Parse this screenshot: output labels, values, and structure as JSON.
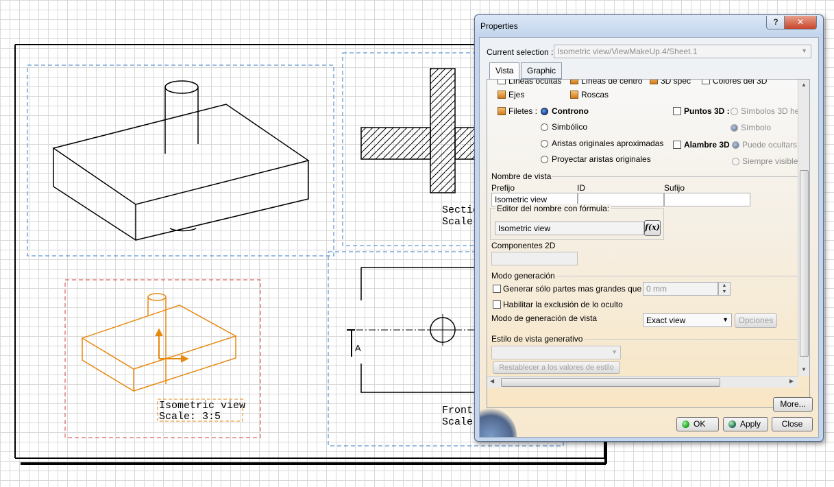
{
  "dialog": {
    "title": "Properties",
    "help": "?",
    "close_glyph": "✕",
    "current_selection_label": "Current selection :",
    "current_selection_value": "Isometric view/ViewMakeUp.4/Sheet.1",
    "tabs": [
      "Vista",
      "Graphic"
    ],
    "partial_row": {
      "a": "Líneas ocultas",
      "b": "Líneas de centro",
      "c": "3D spec",
      "d": "Colores del 3D"
    },
    "ejes": "Ejes",
    "roscas": "Roscas",
    "filetes": "Filetes :",
    "fillet_options": [
      "Controno",
      "Simbólico",
      "Aristas originales aproximadas",
      "Proyectar aristas originales"
    ],
    "puntos3d": "Puntos 3D :",
    "puntos_opts": [
      "Símbolos 3D he",
      "Símbolo"
    ],
    "alambre3d": "Alambre 3D",
    "alambre_opts": [
      "Puede ocultars",
      "Siempre visible"
    ],
    "view_name_section": "Nombre de vista",
    "prefix_label": "Prefijo",
    "id_label": "ID",
    "suffix_label": "Sufijo",
    "prefix_value": "Isometric view",
    "formula_editor_label": "Editor del nombre con fórmula:",
    "formula_value": "Isometric view",
    "fx_label": "f(x)",
    "components_2d": "Componentes 2D",
    "generation_section": "Modo generación",
    "gen_large_parts": "Generar sólo partes mas grandes que",
    "gen_large_value": "0 mm",
    "enable_occlusion": "Habilitar la exclusión de lo oculto",
    "view_generation_mode": "Modo de generación de vista",
    "exact_view": "Exact view",
    "options_btn": "Opciones",
    "generative_style": "Estilo de vista generativo",
    "reset_style": "Restablecer a los valores de estilo",
    "more_btn": "More...",
    "ok_btn": "OK",
    "apply_btn": "Apply",
    "close_btn": "Close"
  },
  "drawing": {
    "iso_label": "Isometric view",
    "iso_scale": "Scale:  3:5",
    "section_label": "Sectio",
    "section_scale": "Scale",
    "front_label": "Front",
    "front_scale": "Scale",
    "section_marker": "A"
  },
  "colors": {
    "selected_view": "#e8890f",
    "frame_dashed": "#3a7dc4",
    "active_frame": "#d9403a"
  }
}
